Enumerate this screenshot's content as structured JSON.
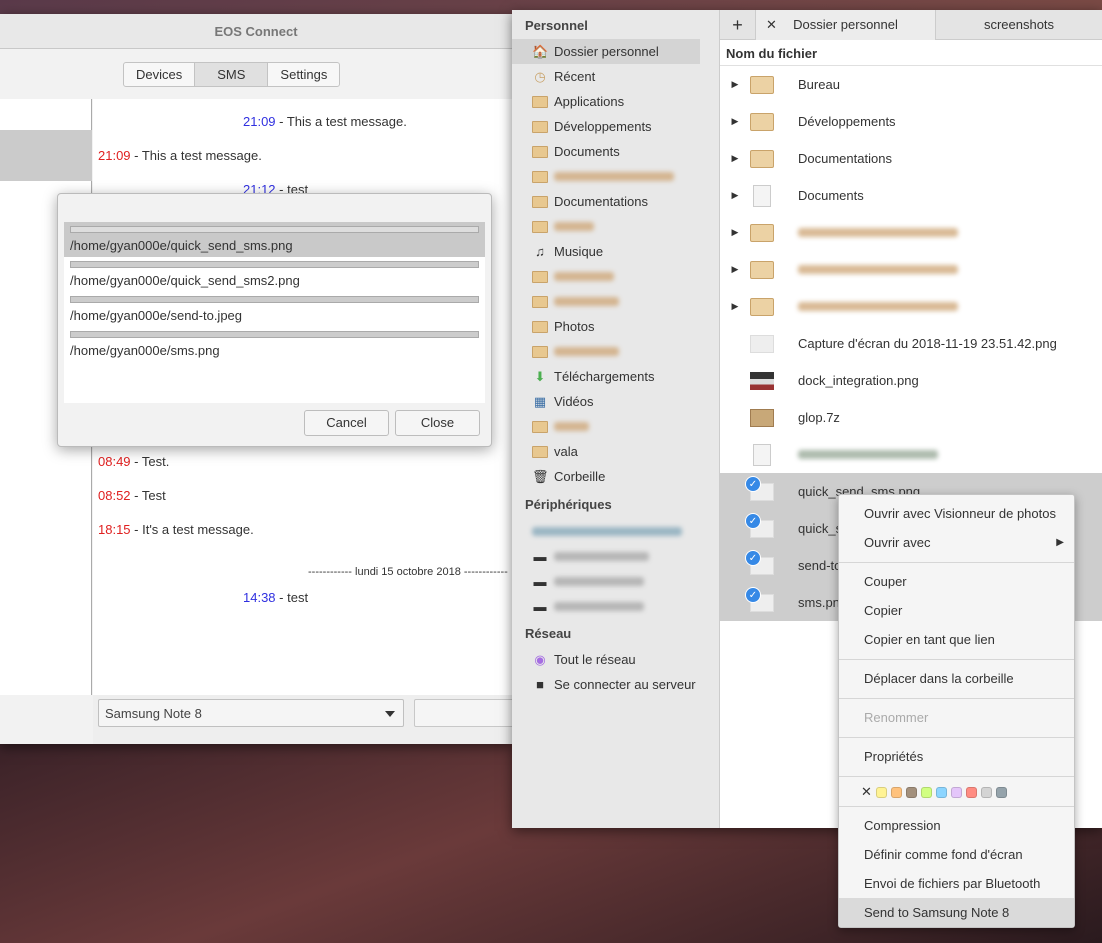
{
  "eos": {
    "title": "EOS Connect",
    "tabs": [
      "Devices",
      "SMS",
      "Settings"
    ],
    "active_tab": "SMS",
    "messages": [
      {
        "time": "21:09",
        "text": " - This a test message.",
        "dir": "out"
      },
      {
        "time": "21:09",
        "text": " - This a test message.",
        "dir": "in"
      },
      {
        "time": "21:12",
        "text": " - test",
        "dir": "out"
      },
      {
        "time": "08:49",
        "text": " - Test.",
        "dir": "in"
      },
      {
        "time": "08:52",
        "text": " - Test",
        "dir": "in"
      },
      {
        "time": "18:15",
        "text": " - It's a test message.",
        "dir": "in"
      },
      {
        "time": "14:38",
        "text": " - test",
        "dir": "out"
      }
    ],
    "date_separator": "------------  lundi 15 octobre 2018  ------------",
    "device_select": "Samsung Note 8",
    "colors": {
      "outgoing": "#3030e0",
      "incoming": "#e02020"
    }
  },
  "dialog": {
    "files": [
      "/home/gyan000e/quick_send_sms.png",
      "/home/gyan000e/quick_send_sms2.png",
      "/home/gyan000e/send-to.jpeg",
      "/home/gyan000e/sms.png"
    ],
    "progress": [
      0,
      0,
      0,
      0
    ],
    "cancel": "Cancel",
    "close": "Close"
  },
  "files": {
    "sidebar": {
      "personal": "Personnel",
      "items": [
        "Dossier personnel",
        "Récent",
        "Applications",
        "Développements",
        "Documents",
        "Documentations",
        "Musique",
        "Photos",
        "Téléchargements",
        "Vidéos",
        "vala",
        "Corbeille"
      ],
      "devices": "Périphériques",
      "network": "Réseau",
      "network_items": [
        "Tout le réseau",
        "Se connecter au serveur"
      ]
    },
    "tabs": [
      "Dossier personnel",
      "screenshots"
    ],
    "column": "Nom du fichier",
    "rows": [
      "Bureau",
      "Développements",
      "Documentations",
      "Documents",
      "",
      "",
      "",
      "Capture d'écran du 2018-11-19 23.51.42.png",
      "dock_integration.png",
      "glop.7z",
      "",
      "quick_send_sms.png",
      "quick_se",
      "send-to.",
      "sms.png"
    ]
  },
  "menu": {
    "items": [
      "Ouvrir avec Visionneur de photos",
      "Ouvrir avec",
      "Couper",
      "Copier",
      "Copier en tant que lien",
      "Déplacer dans la corbeille",
      "Renommer",
      "Propriétés",
      "Compression",
      "Définir comme fond d'écran",
      "Envoi de fichiers par Bluetooth",
      "Send to Samsung Note 8"
    ],
    "tag_colors": [
      "#fff394",
      "#ffc27d",
      "#a3907c",
      "#d1ff82",
      "#8cd5ff",
      "#e4c6fa",
      "#ff8c82",
      "#d4d4d4",
      "#95a3ab"
    ]
  }
}
